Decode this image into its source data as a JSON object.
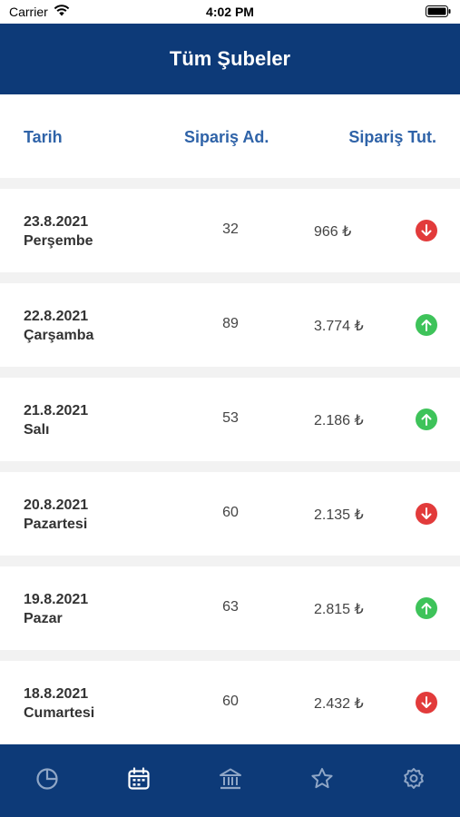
{
  "status_bar": {
    "carrier": "Carrier",
    "time": "4:02 PM"
  },
  "nav": {
    "title": "Tüm Şubeler"
  },
  "columns": {
    "date": "Tarih",
    "count": "Sipariş Ad.",
    "total": "Sipariş Tut."
  },
  "rows": [
    {
      "date": "23.8.2021",
      "day": "Perşembe",
      "count": "32",
      "amount": "966 ₺",
      "trend": "down"
    },
    {
      "date": "22.8.2021",
      "day": "Çarşamba",
      "count": "89",
      "amount": "3.774 ₺",
      "trend": "up"
    },
    {
      "date": "21.8.2021",
      "day": "Salı",
      "count": "53",
      "amount": "2.186 ₺",
      "trend": "up"
    },
    {
      "date": "20.8.2021",
      "day": "Pazartesi",
      "count": "60",
      "amount": "2.135 ₺",
      "trend": "down"
    },
    {
      "date": "19.8.2021",
      "day": "Pazar",
      "count": "63",
      "amount": "2.815 ₺",
      "trend": "up"
    },
    {
      "date": "18.8.2021",
      "day": "Cumartesi",
      "count": "60",
      "amount": "2.432 ₺",
      "trend": "down"
    }
  ],
  "tabs": [
    {
      "icon": "pie-chart-icon",
      "active": false
    },
    {
      "icon": "calendar-icon",
      "active": true
    },
    {
      "icon": "bank-icon",
      "active": false
    },
    {
      "icon": "star-icon",
      "active": false
    },
    {
      "icon": "gear-icon",
      "active": false
    }
  ],
  "colors": {
    "nav": "#0d3a78",
    "header_text": "#2f63a8",
    "down": "#e23b3b",
    "up": "#3ec35a"
  }
}
